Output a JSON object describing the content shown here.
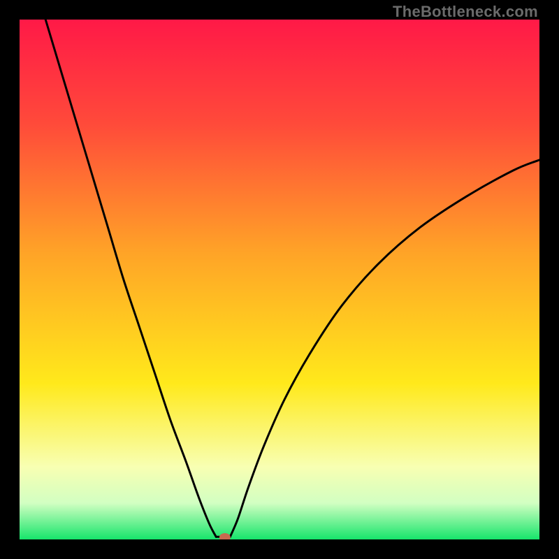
{
  "watermark": "TheBottleneck.com",
  "chart_data": {
    "type": "line",
    "title": "",
    "xlabel": "",
    "ylabel": "",
    "xlim": [
      0,
      100
    ],
    "ylim": [
      0,
      100
    ],
    "grid": false,
    "legend": false,
    "gradient_stops": [
      {
        "offset": 0,
        "color": "#ff1947"
      },
      {
        "offset": 20,
        "color": "#ff4a3a"
      },
      {
        "offset": 45,
        "color": "#ffa427"
      },
      {
        "offset": 70,
        "color": "#ffe91b"
      },
      {
        "offset": 86,
        "color": "#f8ffb2"
      },
      {
        "offset": 93,
        "color": "#d2ffc2"
      },
      {
        "offset": 100,
        "color": "#16e56b"
      }
    ],
    "curve_left": {
      "x": [
        5,
        8,
        11,
        14,
        17,
        20,
        23,
        26,
        29,
        32,
        34.5,
        36.5,
        37.8
      ],
      "y": [
        100,
        90,
        80,
        70,
        60,
        50,
        41,
        32,
        23,
        15,
        8,
        3,
        0.5
      ]
    },
    "curve_right": {
      "x": [
        40.5,
        42,
        44,
        47,
        51,
        56,
        62,
        69,
        77,
        86,
        95,
        100
      ],
      "y": [
        0.5,
        4,
        10,
        18,
        27,
        36,
        45,
        53,
        60,
        66,
        71,
        73
      ]
    },
    "flat_segment": {
      "x": [
        37.8,
        40.5
      ],
      "y": [
        0.5,
        0.5
      ]
    },
    "marker": {
      "x": 39.5,
      "y": 0.4,
      "color": "#c96a4f"
    }
  }
}
